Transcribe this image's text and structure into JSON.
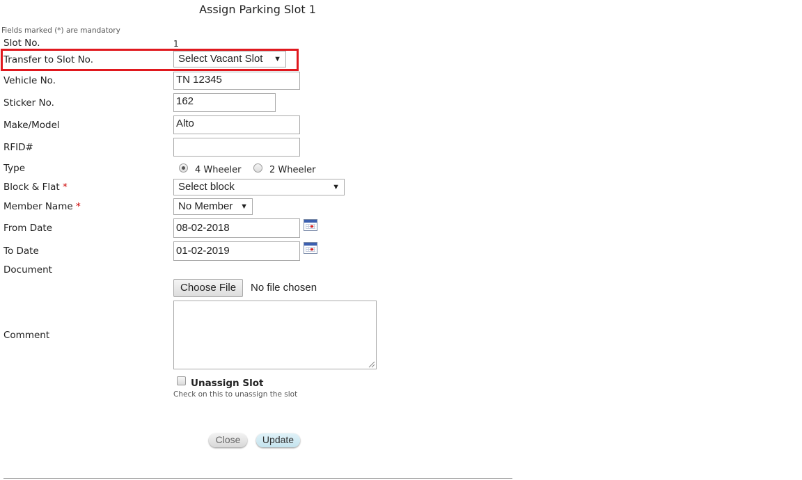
{
  "title": "Assign Parking Slot 1",
  "mandatory_note": "Fields marked (*) are mandatory",
  "slot_no": {
    "label": "Slot No.",
    "value": "1"
  },
  "transfer": {
    "label": "Transfer to Slot No.",
    "selected": "Select Vacant Slot"
  },
  "vehicle_no": {
    "label": "Vehicle No.",
    "value": "TN 12345"
  },
  "sticker_no": {
    "label": "Sticker No.",
    "value": "162"
  },
  "make_model": {
    "label": "Make/Model",
    "value": "Alto"
  },
  "rfid": {
    "label": "RFID#",
    "value": ""
  },
  "type": {
    "label": "Type",
    "options": [
      "4 Wheeler",
      "2 Wheeler"
    ],
    "selected_index": 0
  },
  "block_flat": {
    "label": "Block & Flat",
    "required_mark": "*",
    "selected": "Select block"
  },
  "member_name": {
    "label": "Member Name",
    "required_mark": "*",
    "selected": "No Member"
  },
  "from_date": {
    "label": "From Date",
    "value": "08-02-2018",
    "icon": "calendar-icon"
  },
  "to_date": {
    "label": "To Date",
    "value": "01-02-2019",
    "icon": "calendar-icon"
  },
  "document": {
    "label": "Document",
    "button": "Choose File",
    "status": "No file chosen"
  },
  "comment": {
    "label": "Comment",
    "value": ""
  },
  "unassign": {
    "label": "Unassign Slot",
    "hint": "Check on this to unassign the slot",
    "checked": false
  },
  "buttons": {
    "close": "Close",
    "update": "Update"
  },
  "colors": {
    "highlight": "#e0181e",
    "required": "#cc0000",
    "update_bg": "#cfe9f3"
  }
}
